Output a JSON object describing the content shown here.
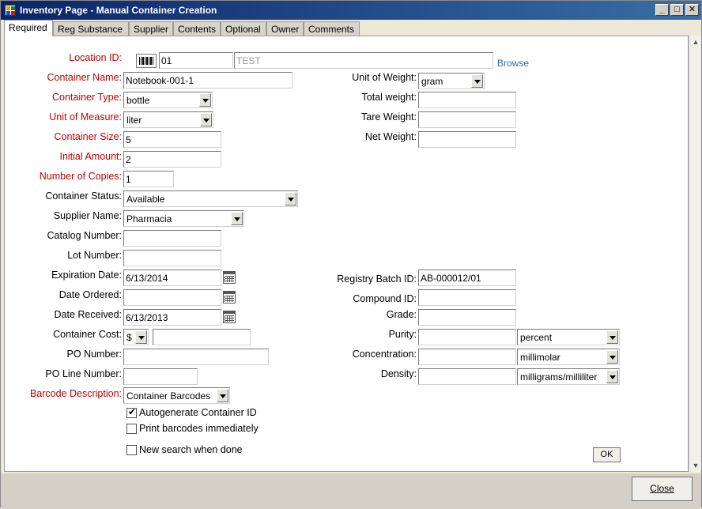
{
  "window": {
    "title": "Inventory Page - Manual Container Creation",
    "controls": {
      "minimize": "_",
      "maximize": "□",
      "close": "✕"
    }
  },
  "tabs": [
    "Required",
    "Reg Substance",
    "Supplier",
    "Contents",
    "Optional",
    "Owner",
    "Comments"
  ],
  "form": {
    "location_id": {
      "label": "Location ID:",
      "value": "01",
      "name": "TEST",
      "browse": "Browse"
    },
    "container_name": {
      "label": "Container Name:",
      "value": "Notebook-001-1"
    },
    "container_type": {
      "label": "Container Type:",
      "value": "bottle"
    },
    "unit_of_measure": {
      "label": "Unit of Measure:",
      "value": "liter"
    },
    "container_size": {
      "label": "Container Size:",
      "value": "5"
    },
    "initial_amount": {
      "label": "Initial Amount:",
      "value": "2"
    },
    "number_of_copies": {
      "label": "Number of Copies:",
      "value": "1"
    },
    "container_status": {
      "label": "Container Status:",
      "value": "Available"
    },
    "supplier_name": {
      "label": "Supplier Name:",
      "value": "Pharmacia"
    },
    "catalog_number": {
      "label": "Catalog Number:",
      "value": ""
    },
    "lot_number": {
      "label": "Lot Number:",
      "value": ""
    },
    "expiration_date": {
      "label": "Expiration Date:",
      "value": "6/13/2014"
    },
    "date_ordered": {
      "label": "Date Ordered:",
      "value": ""
    },
    "date_received": {
      "label": "Date Received:",
      "value": "6/13/2013"
    },
    "container_cost": {
      "label": "Container Cost:",
      "currency": "$",
      "value": ""
    },
    "po_number": {
      "label": "PO Number:",
      "value": ""
    },
    "po_line_number": {
      "label": "PO Line Number:",
      "value": ""
    },
    "barcode_description": {
      "label": "Barcode Description:",
      "value": "Container Barcodes"
    },
    "unit_of_weight": {
      "label": "Unit of Weight:",
      "value": "gram"
    },
    "total_weight": {
      "label": "Total weight:",
      "value": ""
    },
    "tare_weight": {
      "label": "Tare Weight:",
      "value": ""
    },
    "net_weight": {
      "label": "Net Weight:",
      "value": ""
    },
    "registry_batch_id": {
      "label": "Registry Batch ID:",
      "value": "AB-000012/01"
    },
    "compound_id": {
      "label": "Compound ID:",
      "value": ""
    },
    "grade": {
      "label": "Grade:",
      "value": ""
    },
    "purity": {
      "label": "Purity:",
      "value": "",
      "unit": "percent"
    },
    "concentration": {
      "label": "Concentration:",
      "value": "",
      "unit": "millimolar"
    },
    "density": {
      "label": "Density:",
      "value": "",
      "unit": "milligrams/milliliter"
    }
  },
  "options": {
    "autogenerate": {
      "label": "Autogenerate Container ID",
      "checked": true
    },
    "print_barcodes": {
      "label": "Print barcodes immediately",
      "checked": false
    },
    "new_search": {
      "label": "New search when done",
      "checked": false
    }
  },
  "buttons": {
    "ok": "OK",
    "close": "Close"
  },
  "colors": {
    "required_label": "#c00000",
    "link": "#2f6fa7",
    "titlebar": "#0a246a"
  }
}
